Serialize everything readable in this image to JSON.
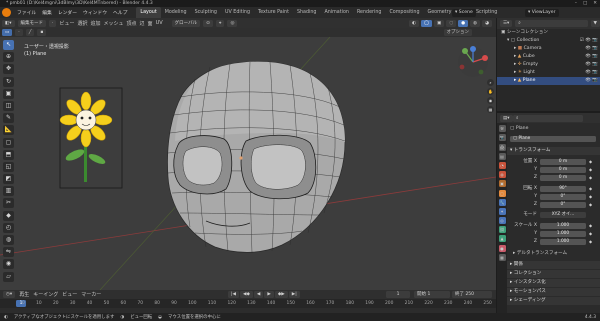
{
  "window": {
    "title": "* pmb01 (D:\\Kel4mgni\\3dBlmy\\3D\\Kel4MTnbered) - Blender 4.4.3",
    "controls": [
      "–",
      "□",
      "✕"
    ]
  },
  "menu": [
    "ファイル",
    "編集",
    "レンダー",
    "ウィンドウ",
    "ヘルプ"
  ],
  "workspaces": [
    "Layout",
    "Modeling",
    "Sculpting",
    "UV Editing",
    "Texture Paint",
    "Shading",
    "Animation",
    "Rendering",
    "Compositing",
    "Geometry Nodes",
    "Scripting"
  ],
  "active_workspace": "Layout",
  "scene": {
    "label": "Scene",
    "view_layer": "ViewLayer"
  },
  "viewport_header": {
    "mode": "編集モード",
    "menus": [
      "ビュー",
      "選択",
      "追加",
      "メッシュ",
      "頂点",
      "辺",
      "面",
      "UV"
    ],
    "transform_orientation": "グローバル",
    "options": "オプション"
  },
  "viewport_info": {
    "view_name": "ユーザー・透視投影",
    "object": "(1) Plane"
  },
  "outliner": {
    "title": "シーンコレクション",
    "rows": [
      {
        "label": "Collection",
        "indent": 1,
        "selected": false
      },
      {
        "label": "Camera",
        "indent": 2,
        "selected": false
      },
      {
        "label": "Cube",
        "indent": 2,
        "selected": false
      },
      {
        "label": "Empty",
        "indent": 2,
        "selected": false
      },
      {
        "label": "Light",
        "indent": 2,
        "selected": false
      },
      {
        "label": "Plane",
        "indent": 2,
        "selected": true
      }
    ]
  },
  "properties": {
    "object_name": "Plane",
    "object_field": "Plane",
    "transform_title": "トランスフォーム",
    "location_label": "位置 X",
    "location": [
      "0 m",
      "0 m",
      "0 m"
    ],
    "rotation_label": "回転 X",
    "rotation": [
      "90°",
      "0°",
      "0°"
    ],
    "mode_label": "モード",
    "mode_value": "XYZ オイ...",
    "scale_label": "スケール X",
    "scale": [
      "1.000",
      "1.000",
      "1.000"
    ],
    "axis_y": "Y",
    "axis_z": "Z",
    "sections": [
      "デルタトランスフォーム",
      "関係",
      "コレクション",
      "インスタンス化",
      "モーションパス",
      "シェーディング"
    ]
  },
  "timeline": {
    "menus": [
      "再生",
      "キーイング",
      "ビュー",
      "マーカー"
    ],
    "current_frame": "1",
    "start_label": "開始",
    "start": "1",
    "end_label": "終了",
    "end": "250",
    "ruler": [
      "0",
      "10",
      "20",
      "30",
      "40",
      "50",
      "60",
      "70",
      "80",
      "90",
      "100",
      "110",
      "120",
      "130",
      "140",
      "150",
      "160",
      "170",
      "180",
      "190",
      "200",
      "210",
      "220",
      "230",
      "240",
      "250"
    ]
  },
  "statusbar": {
    "items": [
      "アクティブなオブジェクトにスケールを適用します",
      "ビュー回転",
      "マウス位置を選択の中心に"
    ],
    "version": "4.4.3"
  },
  "colors": {
    "accent": "#4772b3",
    "selected_row": "#334d80",
    "blender_orange": "#e87d0d",
    "viewport_bg": "#3d3d3d"
  }
}
